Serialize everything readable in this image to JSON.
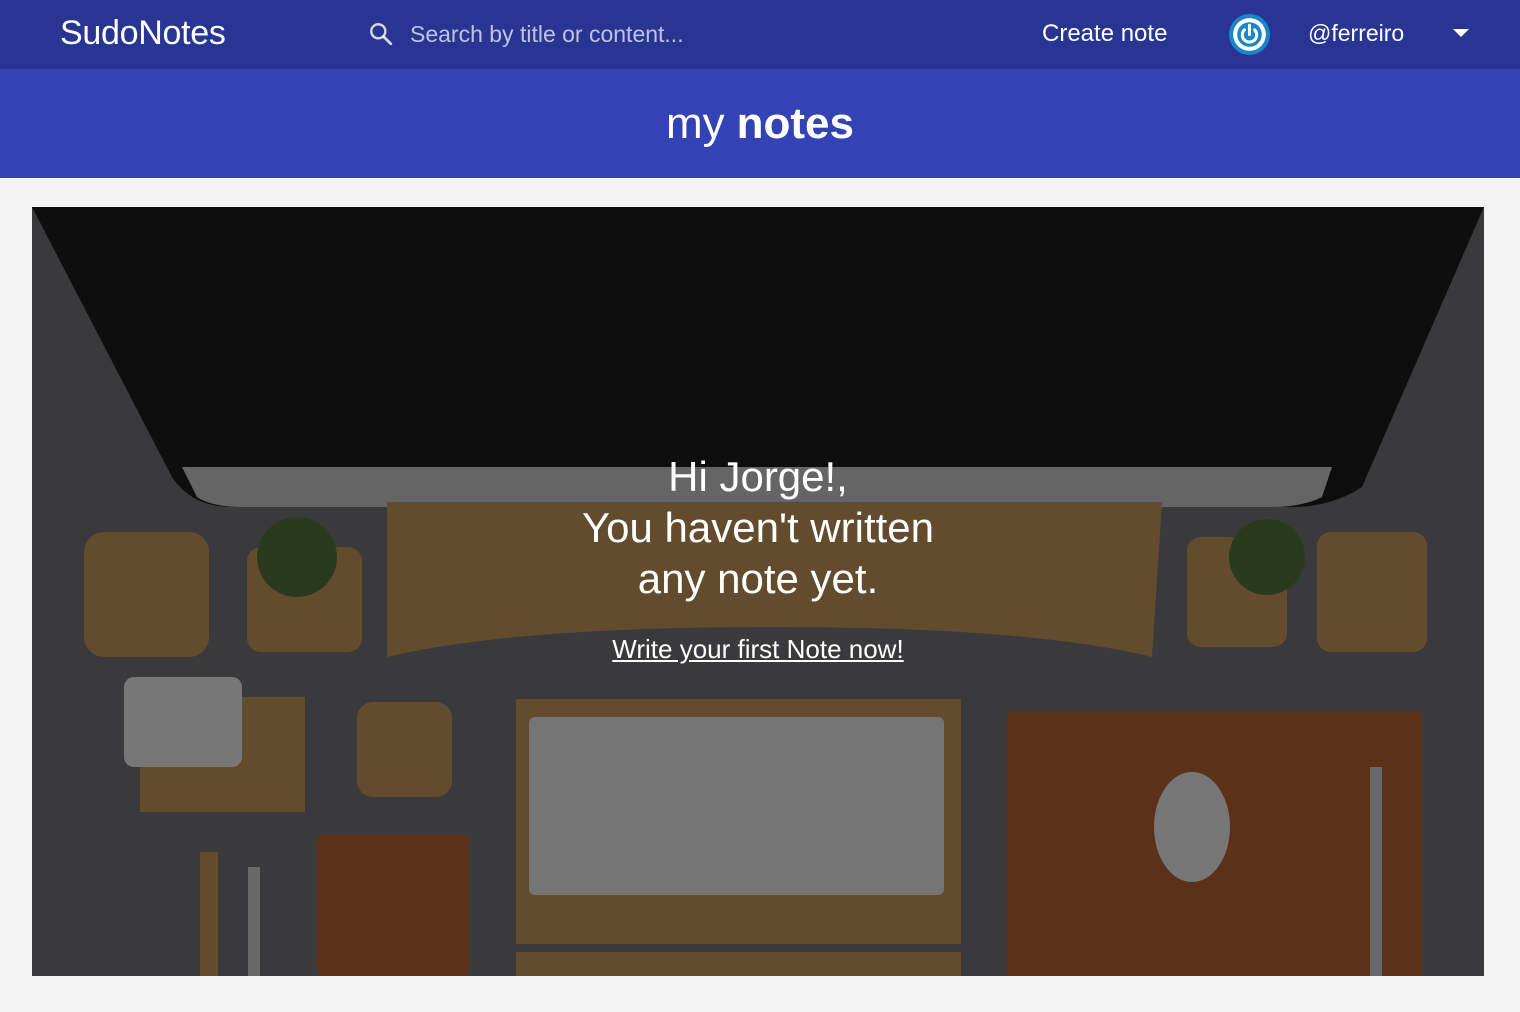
{
  "header": {
    "logo": "SudoNotes",
    "search_placeholder": "Search by title or content...",
    "create_label": "Create note",
    "username": "@ferreiro"
  },
  "title": {
    "regular": "my",
    "bold": "notes"
  },
  "empty_state": {
    "greeting": "Hi Jorge!,",
    "line2": "You haven't written",
    "line3": "any note yet.",
    "cta": "Write your first Note now!"
  },
  "colors": {
    "topbar": "#293593",
    "titlebar": "#3342b4",
    "background": "#f3f3f3",
    "avatar": "#1a86c7"
  },
  "icons": {
    "search": "search-icon",
    "avatar": "power-avatar-icon",
    "dropdown": "caret-down-icon"
  }
}
